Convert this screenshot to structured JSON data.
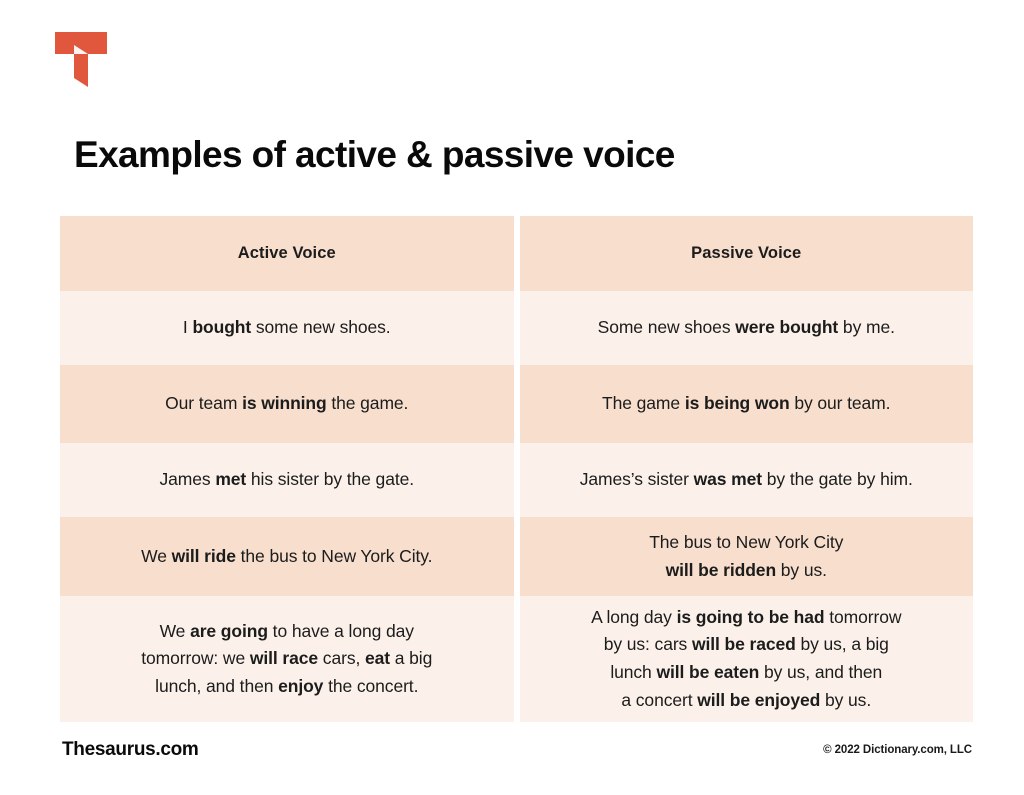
{
  "brand": {
    "logo_icon": "thesaurus-t-logo-icon",
    "logo_color": "#e0573e",
    "footer_name": "Thesaurus.com",
    "copyright": "© 2022 Dictionary.com, LLC"
  },
  "header": {
    "title": "Examples of active & passive voice"
  },
  "theme": {
    "row_dark": "#f7decd",
    "row_light": "#fbf1ea",
    "text": "#1c1c1c",
    "background": "#ffffff"
  },
  "table": {
    "columns": [
      {
        "label": "Active Voice"
      },
      {
        "label": "Passive Voice"
      }
    ],
    "rows": [
      {
        "shade": "light",
        "active": {
          "segments": [
            {
              "text": "I ",
              "bold": false
            },
            {
              "text": "bought",
              "bold": true
            },
            {
              "text": " some new shoes.",
              "bold": false
            }
          ]
        },
        "passive": {
          "segments": [
            {
              "text": "Some new shoes ",
              "bold": false
            },
            {
              "text": "were bought",
              "bold": true
            },
            {
              "text": " by me.",
              "bold": false
            }
          ]
        }
      },
      {
        "shade": "dark",
        "active": {
          "segments": [
            {
              "text": "Our team ",
              "bold": false
            },
            {
              "text": "is winning",
              "bold": true
            },
            {
              "text": " the game.",
              "bold": false
            }
          ]
        },
        "passive": {
          "segments": [
            {
              "text": "The game ",
              "bold": false
            },
            {
              "text": "is being won",
              "bold": true
            },
            {
              "text": " by our team.",
              "bold": false
            }
          ]
        }
      },
      {
        "shade": "light",
        "active": {
          "segments": [
            {
              "text": "James ",
              "bold": false
            },
            {
              "text": "met",
              "bold": true
            },
            {
              "text": " his sister by the gate.",
              "bold": false
            }
          ]
        },
        "passive": {
          "segments": [
            {
              "text": "James’s sister ",
              "bold": false
            },
            {
              "text": "was met",
              "bold": true
            },
            {
              "text": " by the gate by him.",
              "bold": false
            }
          ]
        }
      },
      {
        "shade": "dark",
        "active": {
          "segments": [
            {
              "text": "We ",
              "bold": false
            },
            {
              "text": "will ride",
              "bold": true
            },
            {
              "text": " the bus to New York City.",
              "bold": false
            }
          ]
        },
        "passive": {
          "segments": [
            {
              "text": "The bus to New York City",
              "bold": false
            },
            {
              "text": "\n",
              "bold": false
            },
            {
              "text": "will be ridden",
              "bold": true
            },
            {
              "text": " by us.",
              "bold": false
            }
          ]
        }
      },
      {
        "shade": "light",
        "active": {
          "segments": [
            {
              "text": "We ",
              "bold": false
            },
            {
              "text": "are going",
              "bold": true
            },
            {
              "text": " to have a long day",
              "bold": false
            },
            {
              "text": "\n",
              "bold": false
            },
            {
              "text": "tomorrow: we ",
              "bold": false
            },
            {
              "text": "will race",
              "bold": true
            },
            {
              "text": " cars, ",
              "bold": false
            },
            {
              "text": "eat",
              "bold": true
            },
            {
              "text": " a big",
              "bold": false
            },
            {
              "text": "\n",
              "bold": false
            },
            {
              "text": "lunch, and then ",
              "bold": false
            },
            {
              "text": "enjoy",
              "bold": true
            },
            {
              "text": " the concert.",
              "bold": false
            }
          ]
        },
        "passive": {
          "segments": [
            {
              "text": "A long day ",
              "bold": false
            },
            {
              "text": "is going to be had",
              "bold": true
            },
            {
              "text": " tomorrow",
              "bold": false
            },
            {
              "text": "\n",
              "bold": false
            },
            {
              "text": "by us: cars ",
              "bold": false
            },
            {
              "text": "will be raced",
              "bold": true
            },
            {
              "text": " by us, a big",
              "bold": false
            },
            {
              "text": "\n",
              "bold": false
            },
            {
              "text": "lunch ",
              "bold": false
            },
            {
              "text": "will be eaten",
              "bold": true
            },
            {
              "text": " by us, and then",
              "bold": false
            },
            {
              "text": "\n",
              "bold": false
            },
            {
              "text": "a concert ",
              "bold": false
            },
            {
              "text": "will be enjoyed",
              "bold": true
            },
            {
              "text": " by us.",
              "bold": false
            }
          ]
        }
      }
    ]
  }
}
